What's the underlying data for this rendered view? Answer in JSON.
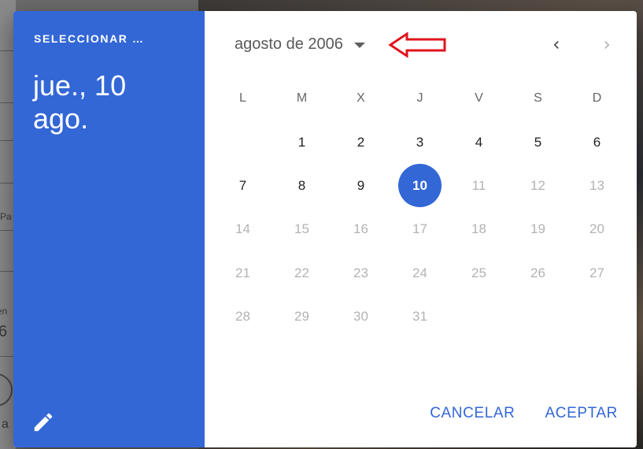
{
  "background": {
    "fragments": [
      "Pa",
      "en",
      "6",
      "a"
    ]
  },
  "dialog": {
    "header": {
      "overline": "SELECCIONAR …",
      "selected_date": "jue., 10 ago."
    },
    "calendar": {
      "month_label": "agosto de 2006",
      "weekdays": [
        "L",
        "M",
        "X",
        "J",
        "V",
        "S",
        "D"
      ],
      "leading_blanks": 1,
      "days": [
        {
          "n": "1",
          "state": "enabled"
        },
        {
          "n": "2",
          "state": "enabled"
        },
        {
          "n": "3",
          "state": "enabled"
        },
        {
          "n": "4",
          "state": "enabled"
        },
        {
          "n": "5",
          "state": "enabled"
        },
        {
          "n": "6",
          "state": "enabled"
        },
        {
          "n": "7",
          "state": "enabled"
        },
        {
          "n": "8",
          "state": "enabled"
        },
        {
          "n": "9",
          "state": "enabled"
        },
        {
          "n": "10",
          "state": "selected"
        },
        {
          "n": "11",
          "state": "disabled"
        },
        {
          "n": "12",
          "state": "disabled"
        },
        {
          "n": "13",
          "state": "disabled"
        },
        {
          "n": "14",
          "state": "disabled"
        },
        {
          "n": "15",
          "state": "disabled"
        },
        {
          "n": "16",
          "state": "disabled"
        },
        {
          "n": "17",
          "state": "disabled"
        },
        {
          "n": "18",
          "state": "disabled"
        },
        {
          "n": "19",
          "state": "disabled"
        },
        {
          "n": "20",
          "state": "disabled"
        },
        {
          "n": "21",
          "state": "disabled"
        },
        {
          "n": "22",
          "state": "disabled"
        },
        {
          "n": "23",
          "state": "disabled"
        },
        {
          "n": "24",
          "state": "disabled"
        },
        {
          "n": "25",
          "state": "disabled"
        },
        {
          "n": "26",
          "state": "disabled"
        },
        {
          "n": "27",
          "state": "disabled"
        },
        {
          "n": "28",
          "state": "disabled"
        },
        {
          "n": "29",
          "state": "disabled"
        },
        {
          "n": "30",
          "state": "disabled"
        },
        {
          "n": "31",
          "state": "disabled"
        }
      ]
    },
    "actions": {
      "cancel_label": "CANCELAR",
      "accept_label": "ACEPTAR"
    }
  },
  "colors": {
    "primary": "#3367d6",
    "annotation_arrow": "#e0141c"
  },
  "icons": {
    "edit": "pencil-icon",
    "prev": "chevron-left-icon",
    "next": "chevron-right-icon",
    "dropdown": "arrow-drop-down-icon"
  }
}
